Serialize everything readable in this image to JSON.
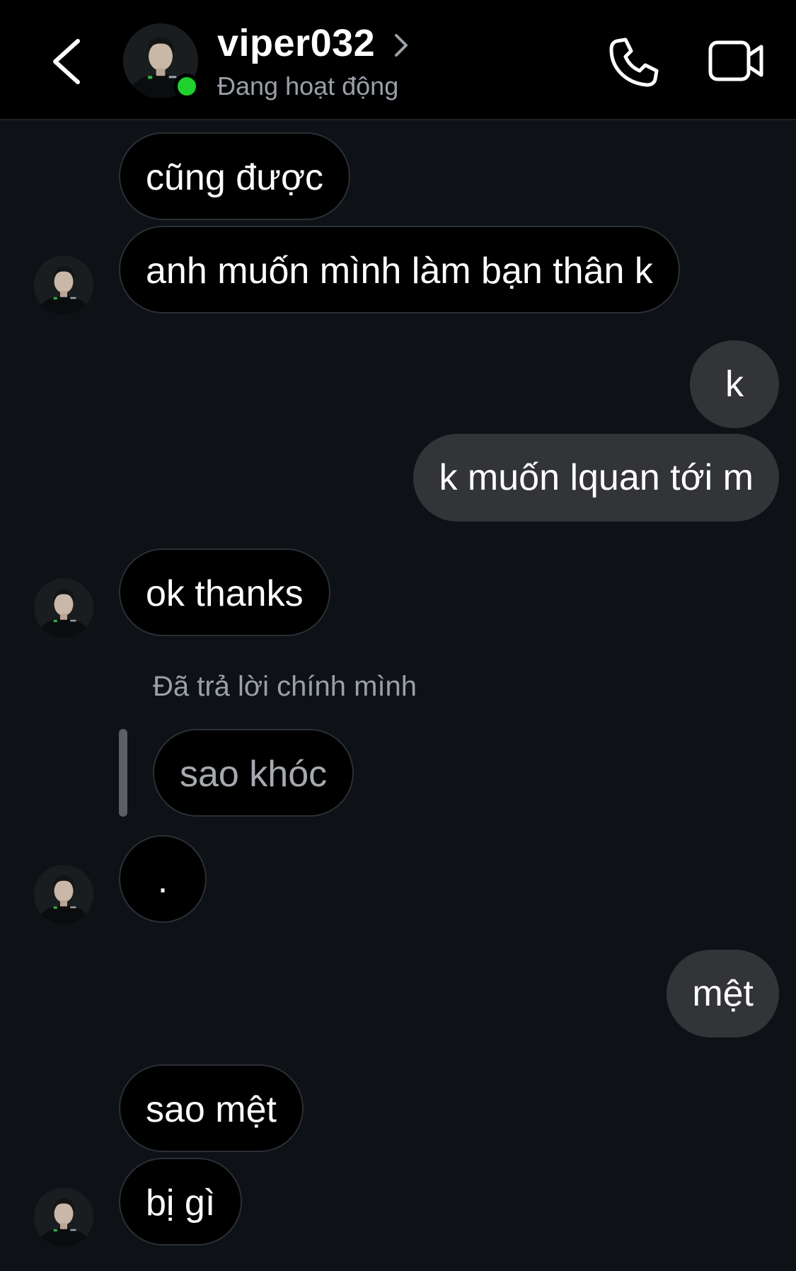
{
  "header": {
    "contact_name": "viper032",
    "status": "Đang hoạt động",
    "icons": {
      "back": "chevron-left-icon",
      "profile": "chevron-right-icon",
      "call": "phone-icon",
      "video": "video-camera-icon"
    },
    "online_color": "#1ed12d"
  },
  "messages": [
    {
      "sender": "them",
      "text": "cũng được"
    },
    {
      "sender": "them",
      "text": "anh muốn mình làm bạn thân k"
    },
    {
      "sender": "me",
      "text": "k"
    },
    {
      "sender": "me",
      "text": "k muốn lquan tới m"
    },
    {
      "sender": "them",
      "text": "ok thanks"
    },
    {
      "sender": "them",
      "text": "sao khóc",
      "reply_label": "Đã trả lời chính mình"
    },
    {
      "sender": "them",
      "text": "."
    },
    {
      "sender": "me",
      "text": "mệt"
    },
    {
      "sender": "them",
      "text": "sao mệt"
    },
    {
      "sender": "them",
      "text": "bị gì"
    }
  ],
  "colors": {
    "background": "#0e1116",
    "outgoing_bubble": "#333437",
    "incoming_bubble": "#000000"
  }
}
